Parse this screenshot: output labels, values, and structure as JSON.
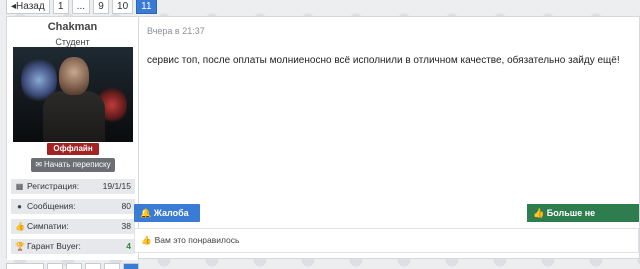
{
  "pagination": {
    "prev_label": "◂Назад",
    "pages": [
      "1",
      "...",
      "9",
      "10",
      "11"
    ],
    "active_page": "11"
  },
  "post": {
    "author": {
      "username": "Chakman",
      "title": "Студент",
      "status": "Оффлайн",
      "pm_button": "Начать переписку",
      "stats": [
        {
          "label": "Регистрация:",
          "value": "19/1/15",
          "icon": "calendar-icon"
        },
        {
          "label": "Сообщения:",
          "value": "80",
          "icon": "comment-icon"
        },
        {
          "label": "Симпатии:",
          "value": "38",
          "icon": "thumbs-up-icon"
        },
        {
          "label": "Гарант Buyer:",
          "value": "4",
          "icon": "trophy-icon"
        }
      ]
    },
    "date": "Вчера в 21:37",
    "message": "сервис топ, после оплаты молниеносно всё исполнили в отличном качестве, обязательно зайду ещё!",
    "report_label": "Жалоба",
    "unlike_label": "Больше не нравится",
    "likes_text": "Вам это понравилось"
  },
  "colors": {
    "accent": "#3a7bd5",
    "offline": "#a52222",
    "unlike": "#2e7d4f",
    "guarant_value": "#2e8b2e"
  }
}
